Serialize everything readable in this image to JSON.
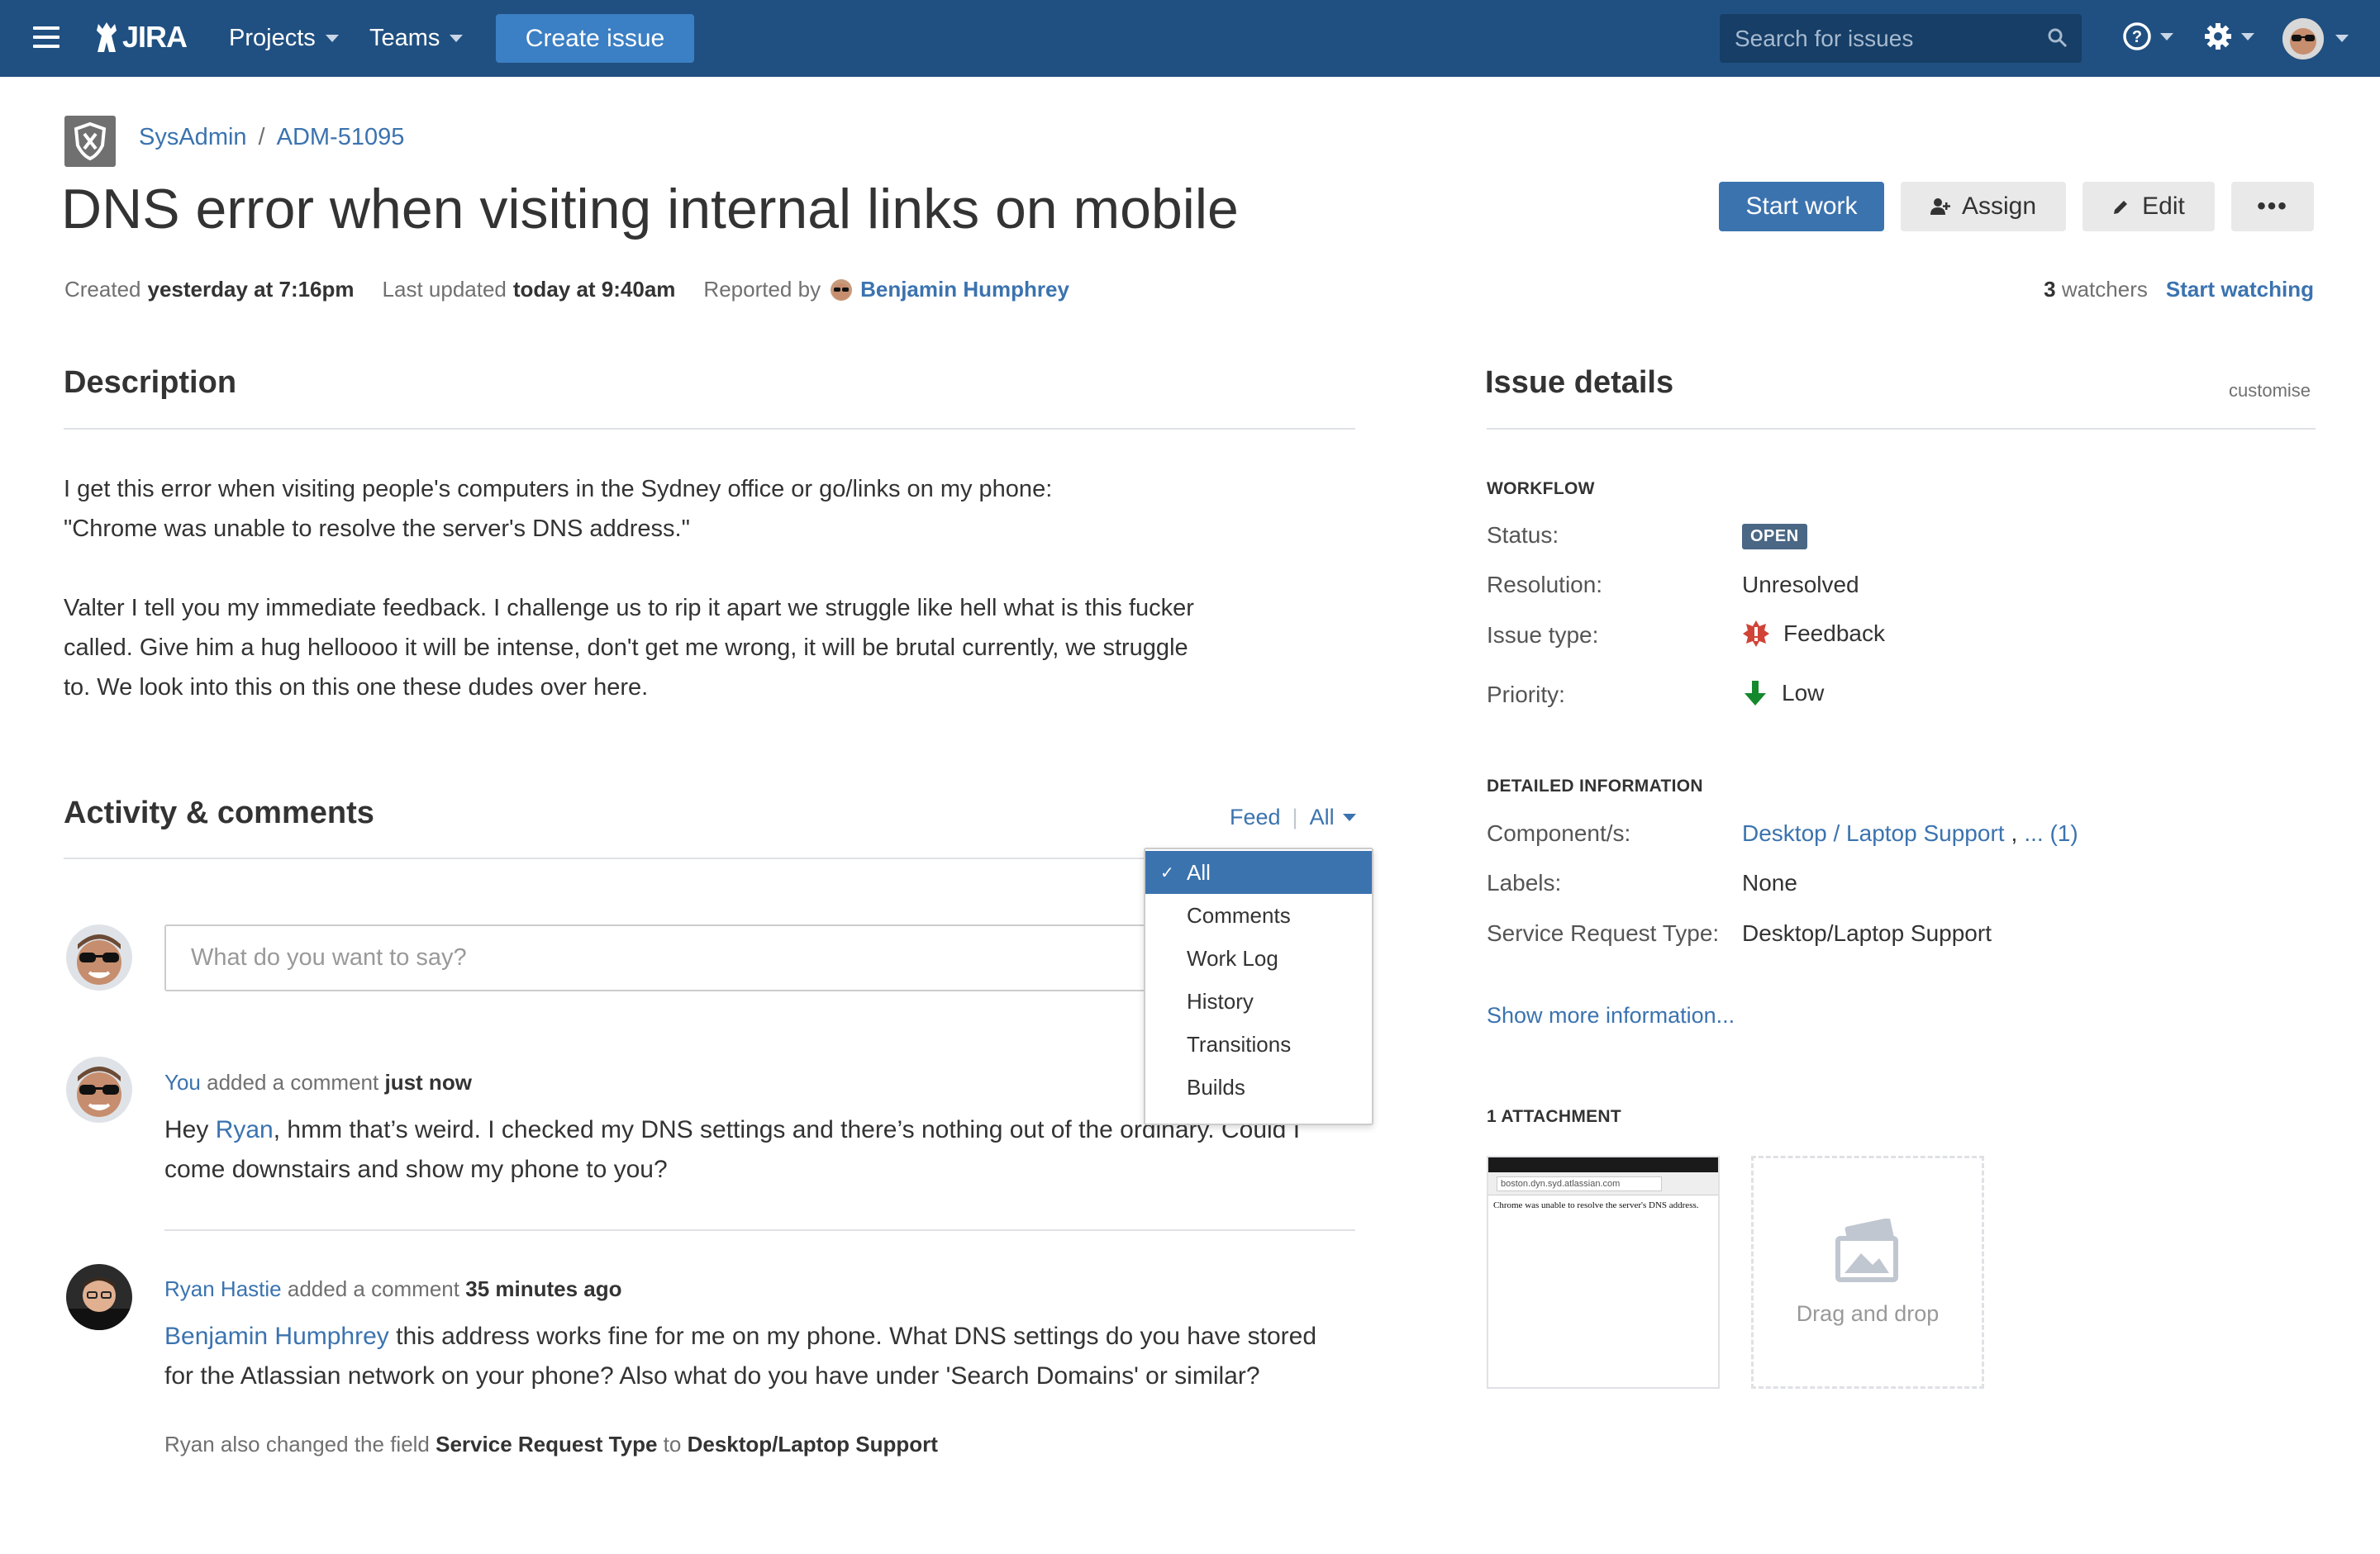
{
  "nav": {
    "logo_text": "JIRA",
    "projects": "Projects",
    "teams": "Teams",
    "create_issue": "Create issue",
    "search_placeholder": "Search for issues",
    "colors": {
      "bar": "#205081",
      "create_button": "#3b7fc4",
      "search_bg": "#163e66"
    }
  },
  "breadcrumb": {
    "project": "SysAdmin",
    "separator": "/",
    "issue_key": "ADM-51095"
  },
  "issue": {
    "title": "DNS error when visiting internal links on mobile",
    "created_label": "Created",
    "created_value": "yesterday at 7:16pm",
    "updated_label": "Last updated",
    "updated_value": "today at 9:40am",
    "reported_label": "Reported by",
    "reporter": "Benjamin Humphrey"
  },
  "actions": {
    "start_work": "Start work",
    "assign": "Assign",
    "edit": "Edit",
    "more": "•••"
  },
  "watchers": {
    "count": "3",
    "label": "watchers",
    "start_watching": "Start watching"
  },
  "description": {
    "heading": "Description",
    "line1": "I get this error when visiting people's computers in the Sydney office or go/links on my phone:",
    "line2": "\"Chrome was unable to resolve the server's DNS address.\"",
    "para2_l1": "Valter I tell you my immediate feedback. I challenge us to rip it apart we struggle like hell what is this fucker",
    "para2_l2": "called. Give him a hug helloooo it will be intense, don't get me wrong, it will be brutal currently, we struggle",
    "para2_l3": "to. We look into this on this one these dudes over here."
  },
  "activity": {
    "heading": "Activity & comments",
    "feed": "Feed",
    "filter": "All",
    "comment_placeholder": "What do you want to say?",
    "dropdown": [
      "All",
      "Comments",
      "Work Log",
      "History",
      "Transitions",
      "Builds"
    ],
    "comments": [
      {
        "author": "You",
        "action": "added a comment",
        "time": "just now",
        "mention": "Ryan",
        "line1_pre": "Hey ",
        "line1_post": ", hmm that’s weird. I checked my DNS settings and there’s nothing out of the ordinary. Could I",
        "line2": "come downstairs and show my phone to you?"
      },
      {
        "author": "Ryan Hastie",
        "action": "added a comment",
        "time": "35 minutes ago",
        "mention": "Benjamin Humphrey",
        "line1_post": " this address works fine for me on my phone. What DNS settings do you have stored",
        "line2": "for the Atlassian network on your phone? Also what do you have under 'Search Domains' or similar?",
        "note_pre": "Ryan also changed the field ",
        "note_field": "Service Request Type",
        "note_to": " to ",
        "note_value": "Desktop/Laptop Support"
      }
    ]
  },
  "details": {
    "heading": "Issue details",
    "customise": "customise",
    "workflow_heading": "WORKFLOW",
    "status_label": "Status:",
    "status_value": "OPEN",
    "resolution_label": "Resolution:",
    "resolution_value": "Unresolved",
    "issue_type_label": "Issue type:",
    "issue_type_value": "Feedback",
    "priority_label": "Priority:",
    "priority_value": "Low",
    "detailed_heading": "DETAILED INFORMATION",
    "components_label": "Component/s:",
    "components_value": "Desktop / Laptop Support",
    "components_more": "... (1)",
    "labels_label": "Labels:",
    "labels_value": "None",
    "srt_label": "Service Request Type:",
    "srt_value": "Desktop/Laptop Support",
    "show_more": "Show more information...",
    "attachment_heading": "1 ATTACHMENT",
    "attachment_url": "boston.dyn.syd.atlassian.com",
    "attachment_text": "Chrome was unable to resolve the server's DNS address.",
    "dropzone": "Drag and drop",
    "colors": {
      "status_lozenge": "#4a6785",
      "feedback_icon": "#d04437",
      "priority_low": "#14892c",
      "link": "#3b73af"
    }
  }
}
